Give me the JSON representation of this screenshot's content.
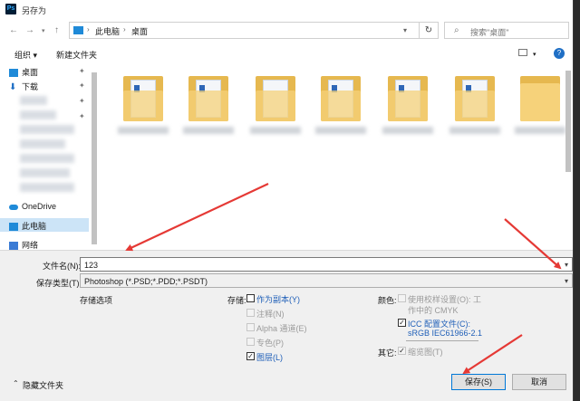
{
  "window": {
    "title": "另存为",
    "app_icon": "Ps"
  },
  "nav": {
    "breadcrumb": [
      "此电脑",
      "桌面"
    ],
    "refresh_icon": "refresh-icon",
    "search_placeholder": "搜索\"桌面\""
  },
  "toolbar": {
    "organize": "组织 ▾",
    "new_folder": "新建文件夹"
  },
  "sidebar": {
    "items": [
      {
        "label": "桌面",
        "icon": "desktop-icon"
      },
      {
        "label": "下载",
        "icon": "download-icon"
      },
      {
        "label": "OneDrive",
        "icon": "cloud-icon"
      },
      {
        "label": "此电脑",
        "icon": "pc-icon"
      },
      {
        "label": "网络",
        "icon": "network-icon"
      }
    ]
  },
  "form": {
    "filename_label": "文件名(N):",
    "filename_value": "123",
    "type_label": "保存类型(T):",
    "type_value": "Photoshop (*.PSD;*.PDD;*.PSDT)"
  },
  "options": {
    "save_options_title": "存储选项",
    "save_label": "存储:",
    "as_copy": "作为副本(Y)",
    "annotations": "注释(N)",
    "alpha": "Alpha 通道(E)",
    "spot": "专色(P)",
    "layers": "图层(L)",
    "color_label": "颜色:",
    "proof_line1": "使用校样设置(O): 工",
    "proof_line2": "作中的 CMYK",
    "icc_line1": "ICC 配置文件(C):",
    "icc_line2": "sRGB IEC61966-2.1",
    "other_label": "其它:",
    "thumbnail": "缩览图(T)"
  },
  "footer": {
    "hide_folders": "隐藏文件夹",
    "save": "保存(S)",
    "cancel": "取消"
  },
  "colors": {
    "accent": "#0078d7",
    "annotation_arrow": "#e53935",
    "folder": "#e6b84f"
  }
}
